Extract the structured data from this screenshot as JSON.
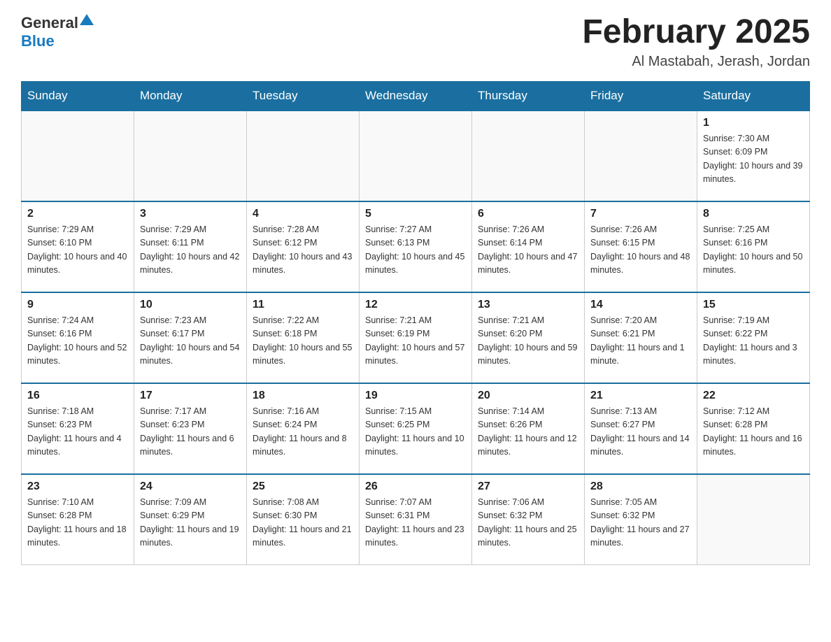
{
  "logo": {
    "general": "General",
    "arrow": "▲",
    "blue": "Blue"
  },
  "title": "February 2025",
  "subtitle": "Al Mastabah, Jerash, Jordan",
  "days_of_week": [
    "Sunday",
    "Monday",
    "Tuesday",
    "Wednesday",
    "Thursday",
    "Friday",
    "Saturday"
  ],
  "weeks": [
    [
      {
        "day": "",
        "info": ""
      },
      {
        "day": "",
        "info": ""
      },
      {
        "day": "",
        "info": ""
      },
      {
        "day": "",
        "info": ""
      },
      {
        "day": "",
        "info": ""
      },
      {
        "day": "",
        "info": ""
      },
      {
        "day": "1",
        "info": "Sunrise: 7:30 AM\nSunset: 6:09 PM\nDaylight: 10 hours and 39 minutes."
      }
    ],
    [
      {
        "day": "2",
        "info": "Sunrise: 7:29 AM\nSunset: 6:10 PM\nDaylight: 10 hours and 40 minutes."
      },
      {
        "day": "3",
        "info": "Sunrise: 7:29 AM\nSunset: 6:11 PM\nDaylight: 10 hours and 42 minutes."
      },
      {
        "day": "4",
        "info": "Sunrise: 7:28 AM\nSunset: 6:12 PM\nDaylight: 10 hours and 43 minutes."
      },
      {
        "day": "5",
        "info": "Sunrise: 7:27 AM\nSunset: 6:13 PM\nDaylight: 10 hours and 45 minutes."
      },
      {
        "day": "6",
        "info": "Sunrise: 7:26 AM\nSunset: 6:14 PM\nDaylight: 10 hours and 47 minutes."
      },
      {
        "day": "7",
        "info": "Sunrise: 7:26 AM\nSunset: 6:15 PM\nDaylight: 10 hours and 48 minutes."
      },
      {
        "day": "8",
        "info": "Sunrise: 7:25 AM\nSunset: 6:16 PM\nDaylight: 10 hours and 50 minutes."
      }
    ],
    [
      {
        "day": "9",
        "info": "Sunrise: 7:24 AM\nSunset: 6:16 PM\nDaylight: 10 hours and 52 minutes."
      },
      {
        "day": "10",
        "info": "Sunrise: 7:23 AM\nSunset: 6:17 PM\nDaylight: 10 hours and 54 minutes."
      },
      {
        "day": "11",
        "info": "Sunrise: 7:22 AM\nSunset: 6:18 PM\nDaylight: 10 hours and 55 minutes."
      },
      {
        "day": "12",
        "info": "Sunrise: 7:21 AM\nSunset: 6:19 PM\nDaylight: 10 hours and 57 minutes."
      },
      {
        "day": "13",
        "info": "Sunrise: 7:21 AM\nSunset: 6:20 PM\nDaylight: 10 hours and 59 minutes."
      },
      {
        "day": "14",
        "info": "Sunrise: 7:20 AM\nSunset: 6:21 PM\nDaylight: 11 hours and 1 minute."
      },
      {
        "day": "15",
        "info": "Sunrise: 7:19 AM\nSunset: 6:22 PM\nDaylight: 11 hours and 3 minutes."
      }
    ],
    [
      {
        "day": "16",
        "info": "Sunrise: 7:18 AM\nSunset: 6:23 PM\nDaylight: 11 hours and 4 minutes."
      },
      {
        "day": "17",
        "info": "Sunrise: 7:17 AM\nSunset: 6:23 PM\nDaylight: 11 hours and 6 minutes."
      },
      {
        "day": "18",
        "info": "Sunrise: 7:16 AM\nSunset: 6:24 PM\nDaylight: 11 hours and 8 minutes."
      },
      {
        "day": "19",
        "info": "Sunrise: 7:15 AM\nSunset: 6:25 PM\nDaylight: 11 hours and 10 minutes."
      },
      {
        "day": "20",
        "info": "Sunrise: 7:14 AM\nSunset: 6:26 PM\nDaylight: 11 hours and 12 minutes."
      },
      {
        "day": "21",
        "info": "Sunrise: 7:13 AM\nSunset: 6:27 PM\nDaylight: 11 hours and 14 minutes."
      },
      {
        "day": "22",
        "info": "Sunrise: 7:12 AM\nSunset: 6:28 PM\nDaylight: 11 hours and 16 minutes."
      }
    ],
    [
      {
        "day": "23",
        "info": "Sunrise: 7:10 AM\nSunset: 6:28 PM\nDaylight: 11 hours and 18 minutes."
      },
      {
        "day": "24",
        "info": "Sunrise: 7:09 AM\nSunset: 6:29 PM\nDaylight: 11 hours and 19 minutes."
      },
      {
        "day": "25",
        "info": "Sunrise: 7:08 AM\nSunset: 6:30 PM\nDaylight: 11 hours and 21 minutes."
      },
      {
        "day": "26",
        "info": "Sunrise: 7:07 AM\nSunset: 6:31 PM\nDaylight: 11 hours and 23 minutes."
      },
      {
        "day": "27",
        "info": "Sunrise: 7:06 AM\nSunset: 6:32 PM\nDaylight: 11 hours and 25 minutes."
      },
      {
        "day": "28",
        "info": "Sunrise: 7:05 AM\nSunset: 6:32 PM\nDaylight: 11 hours and 27 minutes."
      },
      {
        "day": "",
        "info": ""
      }
    ]
  ]
}
